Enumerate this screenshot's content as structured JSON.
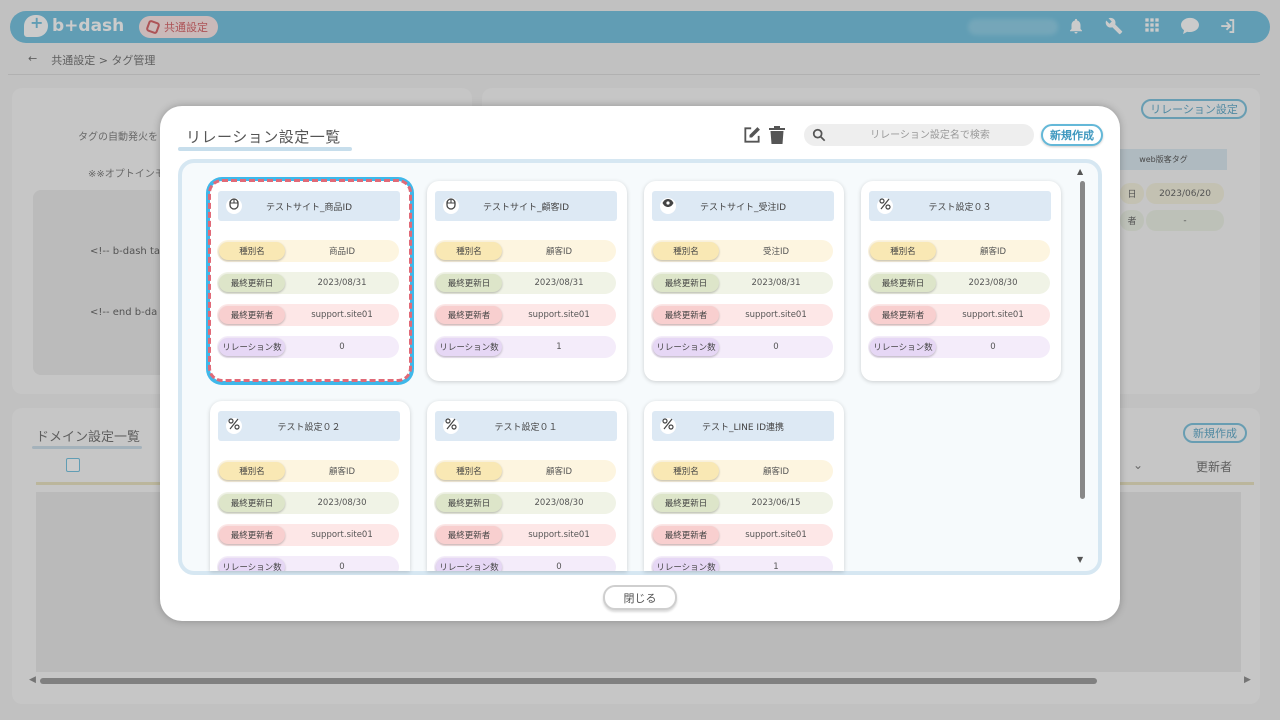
{
  "header": {
    "logo": "b+dash",
    "shared_label": "共通設定",
    "icons": [
      "bell-icon",
      "wrench-icon",
      "grid-icon",
      "chat-icon",
      "logout-icon"
    ]
  },
  "breadcrumb": {
    "back": "←",
    "path": "共通設定 > タグ管理"
  },
  "background": {
    "auto_fire_text": "タグの自動発火を",
    "option_text": "※※オプトインモ",
    "code_lines": [
      "<!-- b-dash ta",
      "<!-- end b-da"
    ],
    "relation_btn": "リレーション設定",
    "table_head": "web版客タグ",
    "cell_date": "2023/06/20",
    "cell_dash": "-",
    "cell_stub1": "日",
    "cell_stub2": "者",
    "domain_title": "ドメイン設定一覧",
    "domain_new_btn": "新規作成",
    "updater_header": "更新者"
  },
  "modal": {
    "title": "リレーション設定一覧",
    "search_placeholder": "リレーション設定名で検索",
    "new_button": "新規作成",
    "close_button": "閉じる",
    "row_labels": {
      "type": "種別名",
      "updated_at": "最終更新日",
      "updated_by": "最終更新者",
      "count": "リレーション数"
    },
    "cards": [
      {
        "name": "テストサイト_商品ID",
        "icon": "mouse-icon",
        "type": "商品ID",
        "updated_at": "2023/08/31",
        "updated_by": "support.site01",
        "count": "0"
      },
      {
        "name": "テストサイト_顧客ID",
        "icon": "mouse-icon",
        "type": "顧客ID",
        "updated_at": "2023/08/31",
        "updated_by": "support.site01",
        "count": "1"
      },
      {
        "name": "テストサイト_受注ID",
        "icon": "eye-icon",
        "type": "受注ID",
        "updated_at": "2023/08/31",
        "updated_by": "support.site01",
        "count": "0"
      },
      {
        "name": "テスト設定０３",
        "icon": "percent-icon",
        "type": "顧客ID",
        "updated_at": "2023/08/30",
        "updated_by": "support.site01",
        "count": "0"
      },
      {
        "name": "テスト設定０２",
        "icon": "percent-icon",
        "type": "顧客ID",
        "updated_at": "2023/08/30",
        "updated_by": "support.site01",
        "count": "0"
      },
      {
        "name": "テスト設定０１",
        "icon": "percent-icon",
        "type": "顧客ID",
        "updated_at": "2023/08/30",
        "updated_by": "support.site01",
        "count": "0"
      },
      {
        "name": "テスト_LINE ID連携",
        "icon": "percent-icon",
        "type": "顧客ID",
        "updated_at": "2023/06/15",
        "updated_by": "support.site01",
        "count": "1"
      }
    ]
  }
}
